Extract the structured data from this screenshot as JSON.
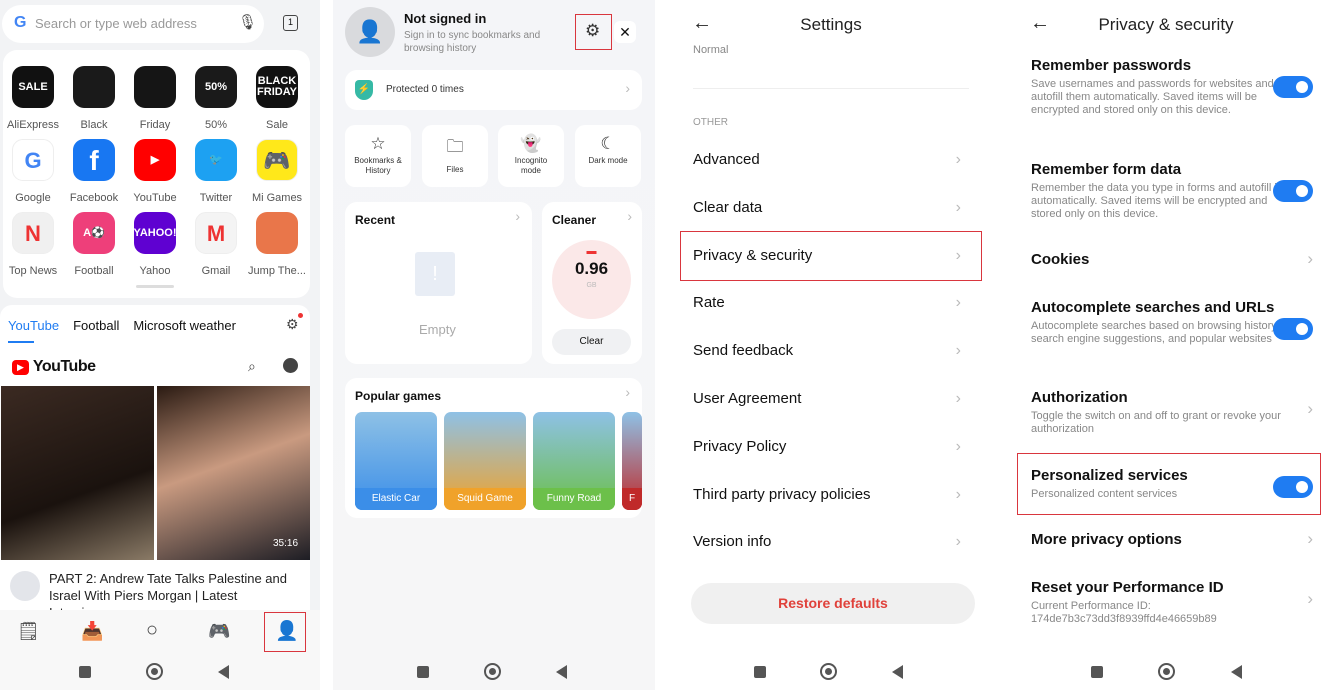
{
  "browser_home": {
    "search_placeholder": "Search or type web address",
    "tab_count": "1",
    "shortcuts": [
      {
        "label": "AliExpress",
        "icon_text": "SALE",
        "color": "#111111"
      },
      {
        "label": "Black",
        "icon_text": "",
        "color": "#1a1a1a"
      },
      {
        "label": "Friday",
        "icon_text": "",
        "color": "#151515"
      },
      {
        "label": "50%",
        "icon_text": "50%",
        "color": "#1a1a1a"
      },
      {
        "label": "Sale",
        "icon_text": "BLACK FRIDAY",
        "color": "#111111"
      },
      {
        "label": "Google",
        "icon_text": "G",
        "color": "#ffffff"
      },
      {
        "label": "Facebook",
        "icon_text": "f",
        "color": "#1877f2"
      },
      {
        "label": "YouTube",
        "icon_text": "▶",
        "color": "#ff0000"
      },
      {
        "label": "Twitter",
        "icon_text": "🐦",
        "color": "#1da1f2"
      },
      {
        "label": "Mi Games",
        "icon_text": "🎮",
        "color": "#ffe81a"
      },
      {
        "label": "Top News",
        "icon_text": "N",
        "color": "#f0f0f0"
      },
      {
        "label": "Football",
        "icon_text": "A⚽",
        "color": "#ee3f7a"
      },
      {
        "label": "Yahoo",
        "icon_text": "YAHOO!",
        "color": "#5f01d1"
      },
      {
        "label": "Gmail",
        "icon_text": "M",
        "color": "#f4f4f4"
      },
      {
        "label": "Jump The...",
        "icon_text": "",
        "color": "#e9764a"
      }
    ],
    "feed_tabs": [
      "YouTube",
      "Football",
      "Microsoft weather"
    ],
    "feed_active_tab": "YouTube",
    "youtube_logo_text": "YouTube",
    "video_duration": "35:16",
    "video_title": "PART 2: Andrew Tate Talks Palestine and Israel With Piers Morgan | Latest Interview",
    "bottom_nav": [
      "news-icon",
      "downloads-icon",
      "search-icon",
      "games-icon",
      "profile-icon"
    ]
  },
  "profile_menu": {
    "title": "Not signed in",
    "subtitle": "Sign in to sync bookmarks and browsing history",
    "protected_text": "Protected 0 times",
    "quick_actions": [
      "Bookmarks & History",
      "Files",
      "Incognito mode",
      "Dark mode"
    ],
    "recent_title": "Recent",
    "recent_empty": "Empty",
    "cleaner_title": "Cleaner",
    "cleaner_value": "0.96",
    "cleaner_unit": "GB",
    "cleaner_button": "Clear",
    "games_title": "Popular games",
    "games": [
      {
        "label": "Elastic Car",
        "color": "#3b8ee8"
      },
      {
        "label": "Squid Game",
        "color": "#f0a22a"
      },
      {
        "label": "Funny Road",
        "color": "#6cc04a"
      },
      {
        "label": "F",
        "color": "#c02a2a"
      }
    ]
  },
  "settings": {
    "title": "Settings",
    "partial_value": "Normal",
    "section_label": "OTHER",
    "items": [
      "Advanced",
      "Clear data",
      "Privacy & security",
      "Rate",
      "Send feedback",
      "User Agreement",
      "Privacy Policy",
      "Third party privacy policies",
      "Version info"
    ],
    "highlighted_item": "Privacy & security",
    "restore_button": "Restore defaults"
  },
  "privacy": {
    "title": "Privacy & security",
    "items": [
      {
        "title": "Remember passwords",
        "desc": "Save usernames and passwords for websites and autofill them automatically. Saved items will be encrypted and stored only on this device.",
        "control": "toggle",
        "on": true
      },
      {
        "title": "Remember form data",
        "desc": "Remember the data you type in forms and autofill it automatically. Saved items will be encrypted and stored only on this device.",
        "control": "toggle",
        "on": true
      },
      {
        "title": "Cookies",
        "desc": "",
        "control": "chevron"
      },
      {
        "title": "Autocomplete searches and URLs",
        "desc": "Autocomplete searches based on browsing history, search engine suggestions, and popular websites",
        "control": "toggle",
        "on": true
      },
      {
        "title": "Authorization",
        "desc": "Toggle the switch on and off to grant or revoke your authorization",
        "control": "chevron"
      },
      {
        "title": "Personalized services",
        "desc": "Personalized content services",
        "control": "toggle",
        "on": true
      },
      {
        "title": "More privacy options",
        "desc": "",
        "control": "chevron"
      },
      {
        "title": "Reset your Performance ID",
        "desc": "Current Performance ID: 174de7b3c73dd3f8939ffd4e46659b89",
        "control": "chevron"
      }
    ]
  },
  "colors": {
    "accent": "#1f7cf2",
    "highlight_box": "#d9363e",
    "restore_text": "#e0413a"
  }
}
